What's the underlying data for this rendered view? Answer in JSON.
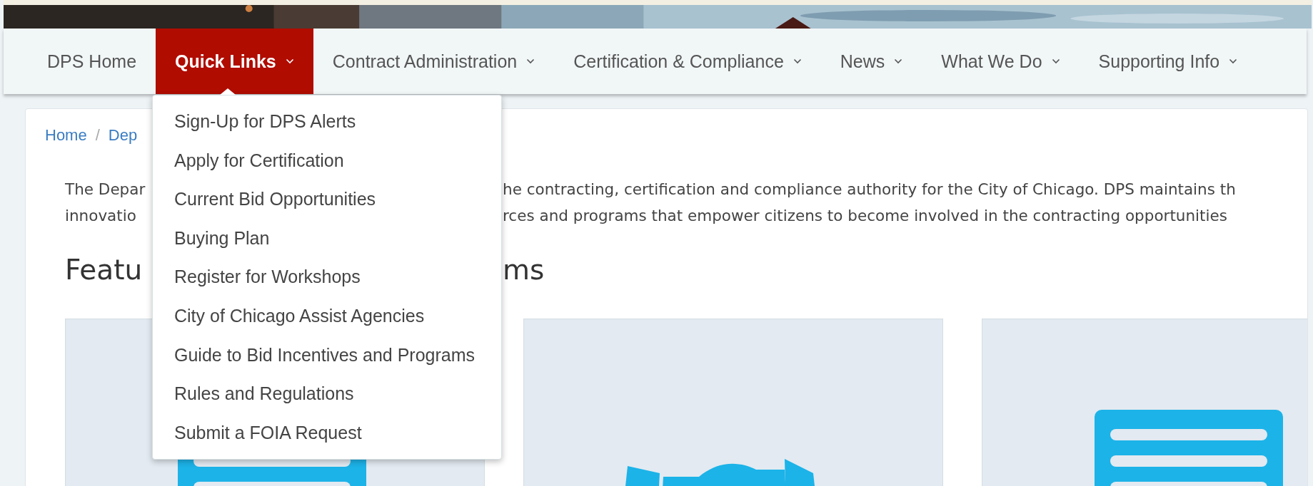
{
  "nav": {
    "items": [
      {
        "label": "DPS Home",
        "dropdown": false,
        "selected": false
      },
      {
        "label": "Quick Links",
        "dropdown": true,
        "selected": true
      },
      {
        "label": "Contract Administration",
        "dropdown": true,
        "selected": false
      },
      {
        "label": "Certification & Compliance",
        "dropdown": true,
        "selected": false
      },
      {
        "label": "News",
        "dropdown": true,
        "selected": false
      },
      {
        "label": "What We Do",
        "dropdown": true,
        "selected": false
      },
      {
        "label": "Supporting Info",
        "dropdown": true,
        "selected": false
      }
    ]
  },
  "dropdown_menu": {
    "items": [
      "Sign-Up for DPS Alerts",
      "Apply for Certification",
      "Current Bid Opportunities",
      "Buying Plan",
      "Register for Workshops",
      "City of Chicago Assist Agencies",
      "Guide to Bid Incentives and Programs",
      "Rules and Regulations",
      "Submit a FOIA Request"
    ]
  },
  "breadcrumb": [
    {
      "kind": "link",
      "text": "Home"
    },
    {
      "kind": "separator",
      "text": "/"
    },
    {
      "kind": "link",
      "text": "Dep"
    }
  ],
  "intro_lines": [
    {
      "left": "The Depar",
      "right": "he contracting, certification and compliance authority for the City of Chicago. DPS maintains th"
    },
    {
      "left": "innovatio",
      "right": "rces and programs that empower citizens to become involved in the contracting opportunities"
    }
  ],
  "heading": {
    "left": "Featu",
    "right": "ms"
  },
  "cards": [
    {
      "kind": "document"
    },
    {
      "kind": "handshake"
    },
    {
      "kind": "document"
    }
  ]
}
